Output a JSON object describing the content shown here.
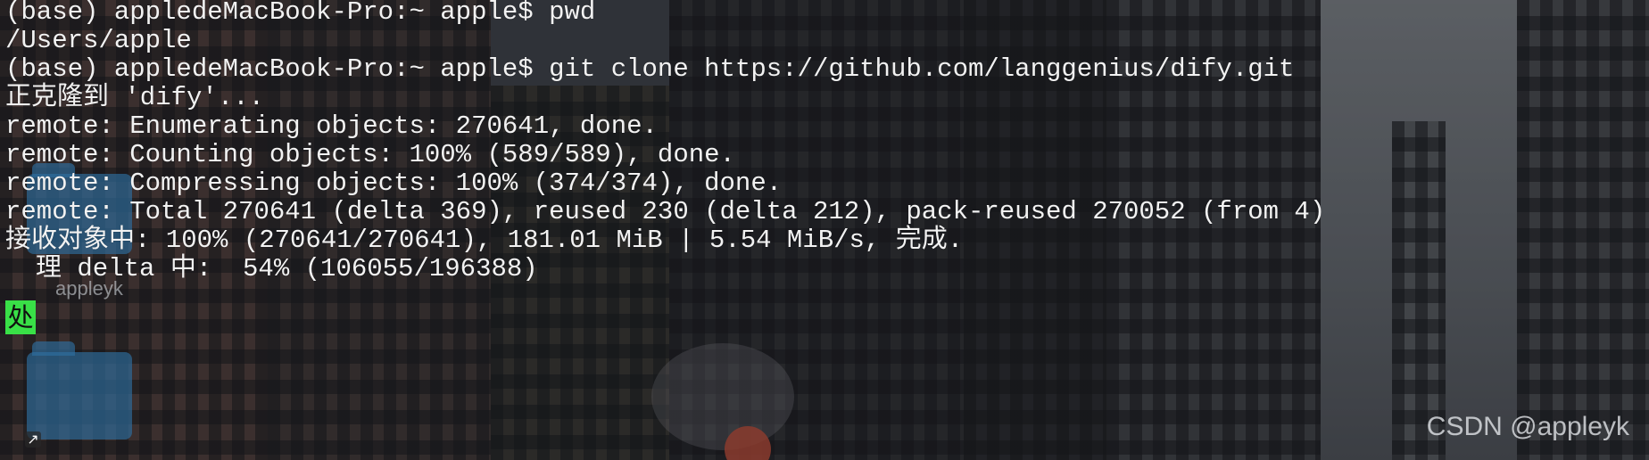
{
  "terminal": {
    "lines": [
      "(base) appledeMacBook-Pro:~ apple$ pwd",
      "/Users/apple",
      "(base) appledeMacBook-Pro:~ apple$ git clone https://github.com/langgenius/dify.git",
      "正克隆到 'dify'...",
      "remote: Enumerating objects: 270641, done.",
      "remote: Counting objects: 100% (589/589), done.",
      "remote: Compressing objects: 100% (374/374), done.",
      "remote: Total 270641 (delta 369), reused 230 (delta 212), pack-reused 270052 (from 4)",
      "接收对象中: 100% (270641/270641), 181.01 MiB | 5.54 MiB/s, 完成."
    ],
    "cursor_char": "处",
    "last_line_rest": "理 delta 中:  54% (106055/196388)",
    "cursor_color": "#39e047"
  },
  "desktop": {
    "folder_label": "appleyk"
  },
  "watermark": "CSDN @appleyk"
}
